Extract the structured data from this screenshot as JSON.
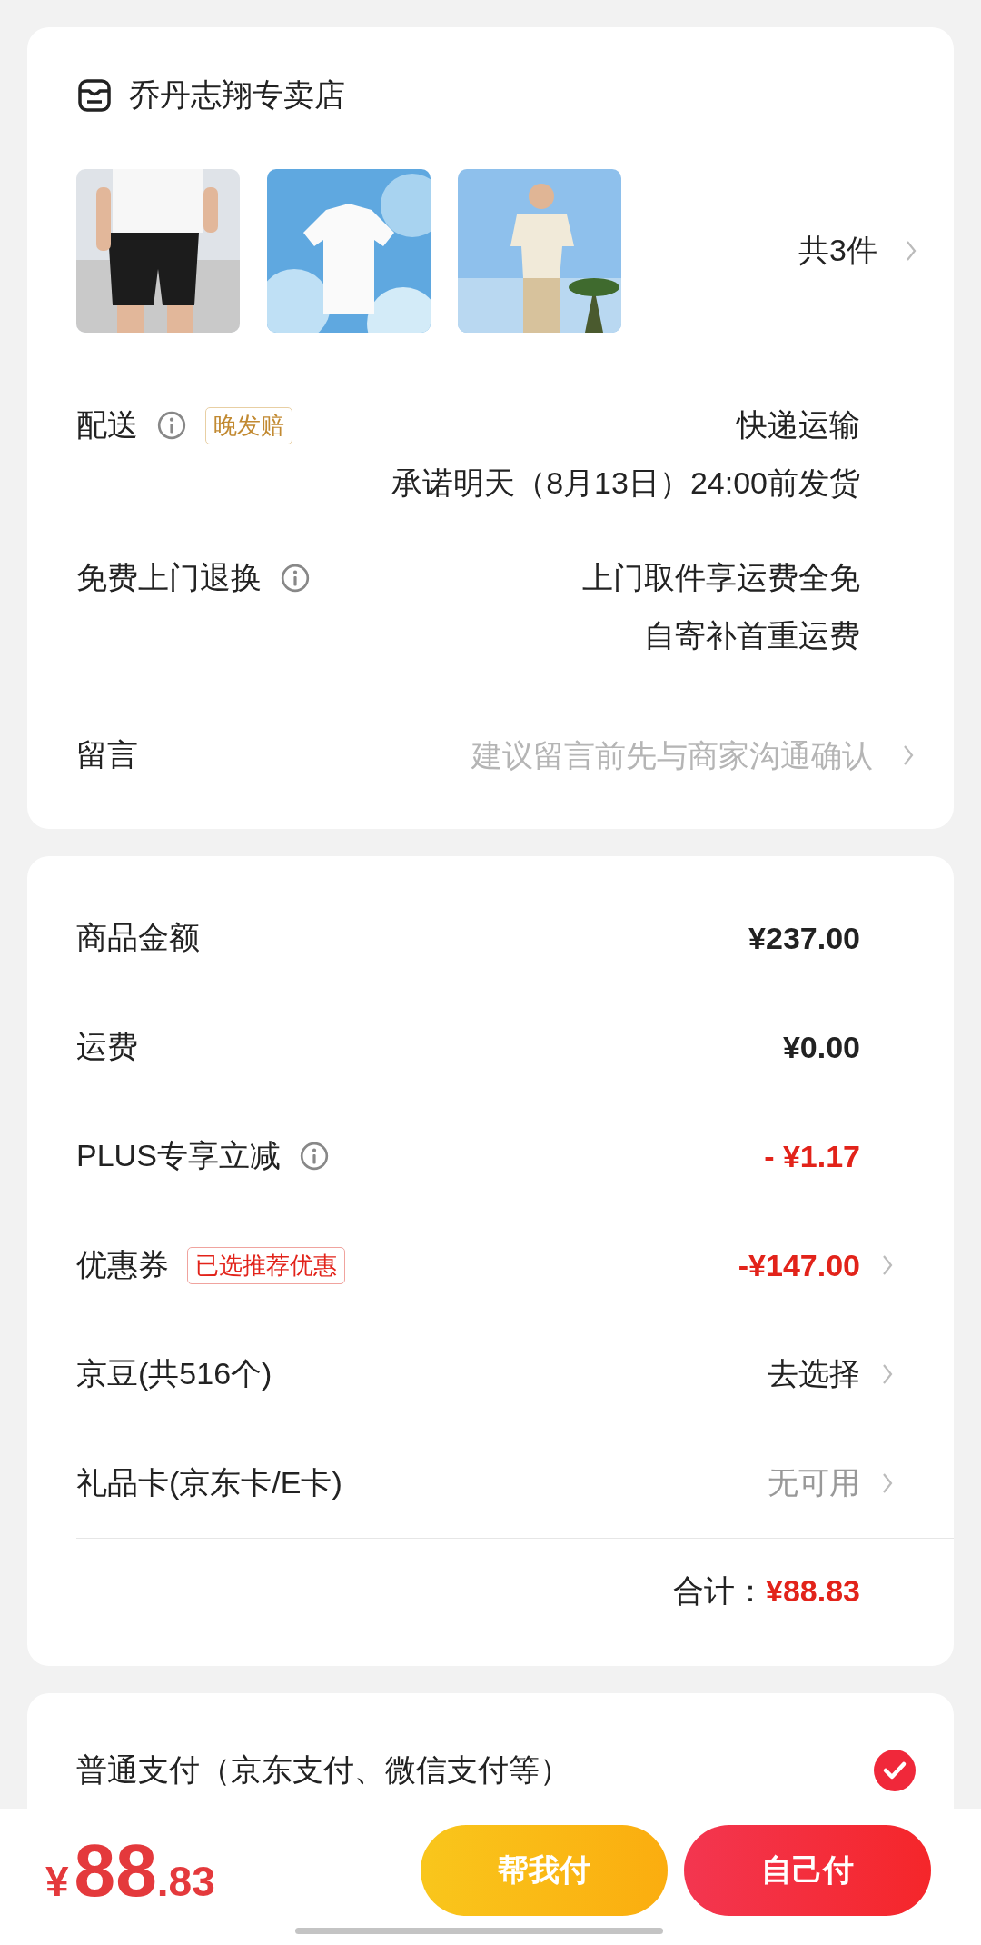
{
  "store": {
    "name": "乔丹志翔专卖店",
    "count": "共3件"
  },
  "info_rows": [
    {
      "label": "配送",
      "info_icon": true,
      "badge": "晚发赔",
      "lines": [
        "快递运输",
        "承诺明天（8月13日）24:00前发货"
      ]
    },
    {
      "label": "免费上门退换",
      "info_icon": true,
      "lines": [
        "上门取件享运费全免",
        "自寄补首重运费"
      ]
    }
  ],
  "message": {
    "label": "留言",
    "placeholder": "建议留言前先与商家沟通确认"
  },
  "price_rows": [
    {
      "label": "商品金额",
      "info_icon": false,
      "value": "¥237.00",
      "kind": "amount",
      "chevron": false
    },
    {
      "label": "运费",
      "info_icon": false,
      "value": "¥0.00",
      "kind": "amount",
      "chevron": false
    },
    {
      "label": "PLUS专享立减",
      "info_icon": true,
      "value": "- ¥1.17",
      "kind": "discount",
      "chevron": false
    },
    {
      "label": "优惠券",
      "info_icon": false,
      "badge": "已选推荐优惠",
      "value": "-¥147.00",
      "kind": "discount",
      "chevron": true
    },
    {
      "label": "京豆(共516个)",
      "info_icon": false,
      "value": "去选择",
      "kind": "action",
      "chevron": true
    },
    {
      "label": "礼品卡(京东卡/E卡)",
      "info_icon": false,
      "value": "无可用",
      "kind": "unavailable",
      "chevron": true
    }
  ],
  "total": {
    "label": "合计：",
    "value": "¥88.83"
  },
  "payment": {
    "label": "普通支付（京东支付、微信支付等）",
    "selected": true
  },
  "bottom_bar": {
    "currency": "¥",
    "price_int": "88",
    "price_dec": ".83",
    "buttons": [
      {
        "label": "帮我付",
        "kind": "secondary"
      },
      {
        "label": "自己付",
        "kind": "primary"
      }
    ]
  }
}
